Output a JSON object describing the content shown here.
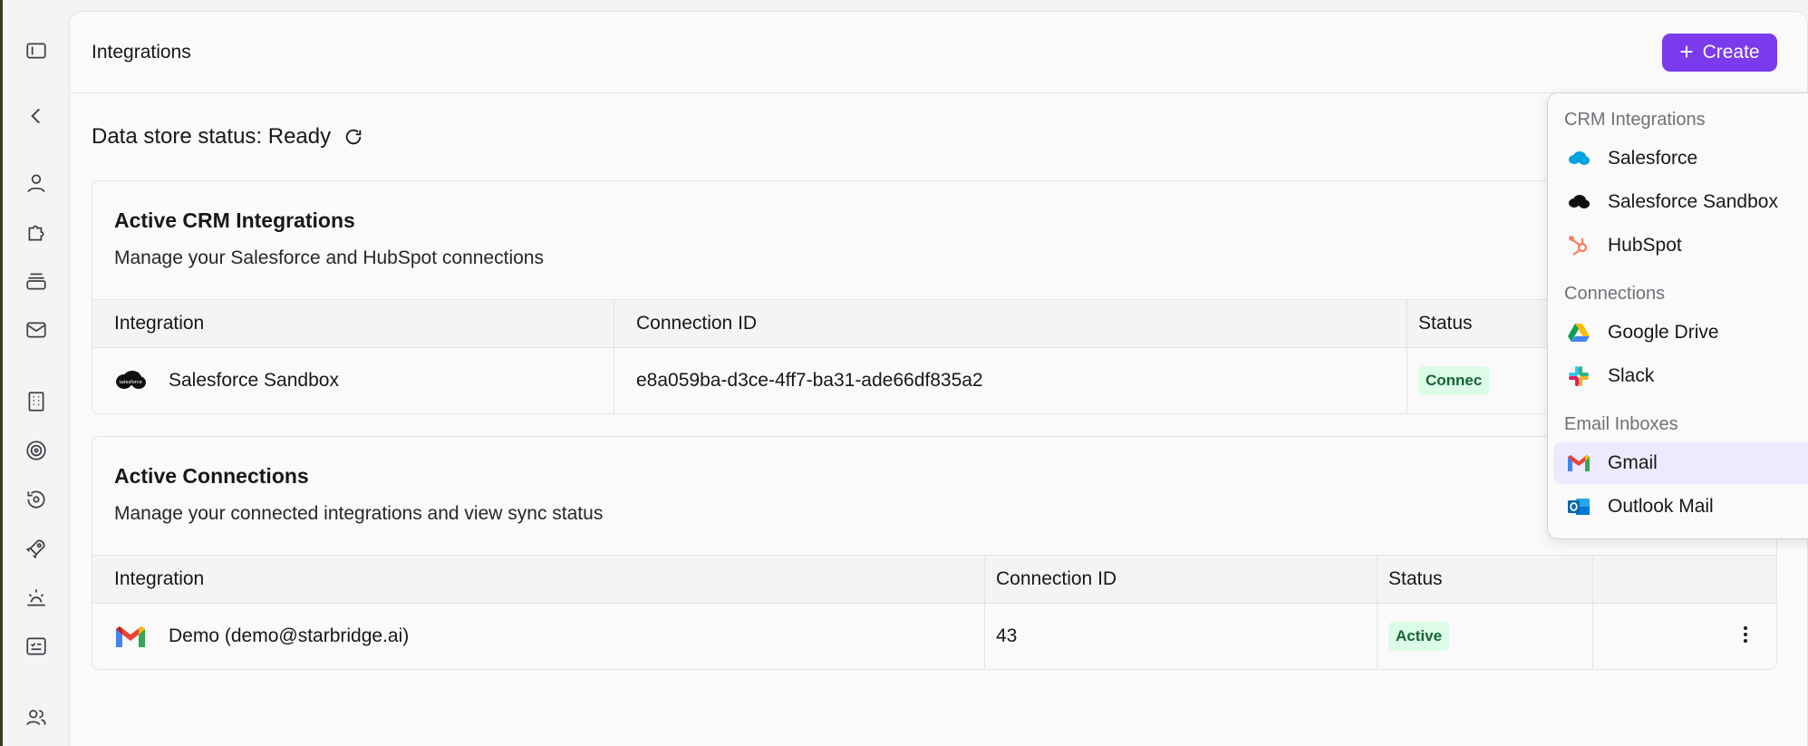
{
  "header": {
    "title": "Integrations",
    "create_label": "Create"
  },
  "status": {
    "text": "Data store status: Ready"
  },
  "crm_card": {
    "title": "Active CRM Integrations",
    "subtitle": "Manage your Salesforce and HubSpot connections",
    "columns": [
      "Integration",
      "Connection ID",
      "Status"
    ],
    "rows": [
      {
        "integration": "Salesforce Sandbox",
        "connection_id": "e8a059ba-d3ce-4ff7-ba31-ade66df835a2",
        "status": "Connec",
        "logo": "salesforce-icon"
      }
    ]
  },
  "connections_card": {
    "title": "Active Connections",
    "subtitle": "Manage your connected integrations and view sync status",
    "columns": [
      "Integration",
      "Connection ID",
      "Status"
    ],
    "rows": [
      {
        "integration": "Demo (demo@starbridge.ai)",
        "connection_id": "43",
        "status": "Active",
        "logo": "gmail-icon"
      }
    ]
  },
  "dropdown": {
    "groups": [
      {
        "label": "CRM Integrations",
        "items": [
          {
            "label": "Salesforce",
            "icon": "salesforce-icon"
          },
          {
            "label": "Salesforce Sandbox",
            "icon": "salesforce-sandbox-icon"
          },
          {
            "label": "HubSpot",
            "icon": "hubspot-icon"
          }
        ]
      },
      {
        "label": "Connections",
        "items": [
          {
            "label": "Google Drive",
            "icon": "google-drive-icon"
          },
          {
            "label": "Slack",
            "icon": "slack-icon"
          }
        ]
      },
      {
        "label": "Email Inboxes",
        "items": [
          {
            "label": "Gmail",
            "icon": "gmail-icon"
          },
          {
            "label": "Outlook Mail",
            "icon": "outlook-icon"
          }
        ]
      }
    ]
  },
  "rail": [
    "sidebar-toggle-icon",
    "back-icon",
    "user-icon",
    "puzzle-icon",
    "layers-icon",
    "mail-icon",
    "building-icon",
    "target-icon",
    "history-icon",
    "rocket-icon",
    "sunrise-icon",
    "checklist-icon",
    "users-icon"
  ],
  "colors": {
    "accent": "#7c3aed",
    "active_badge": "#dcfce7",
    "highlight": "#ede9fe"
  }
}
